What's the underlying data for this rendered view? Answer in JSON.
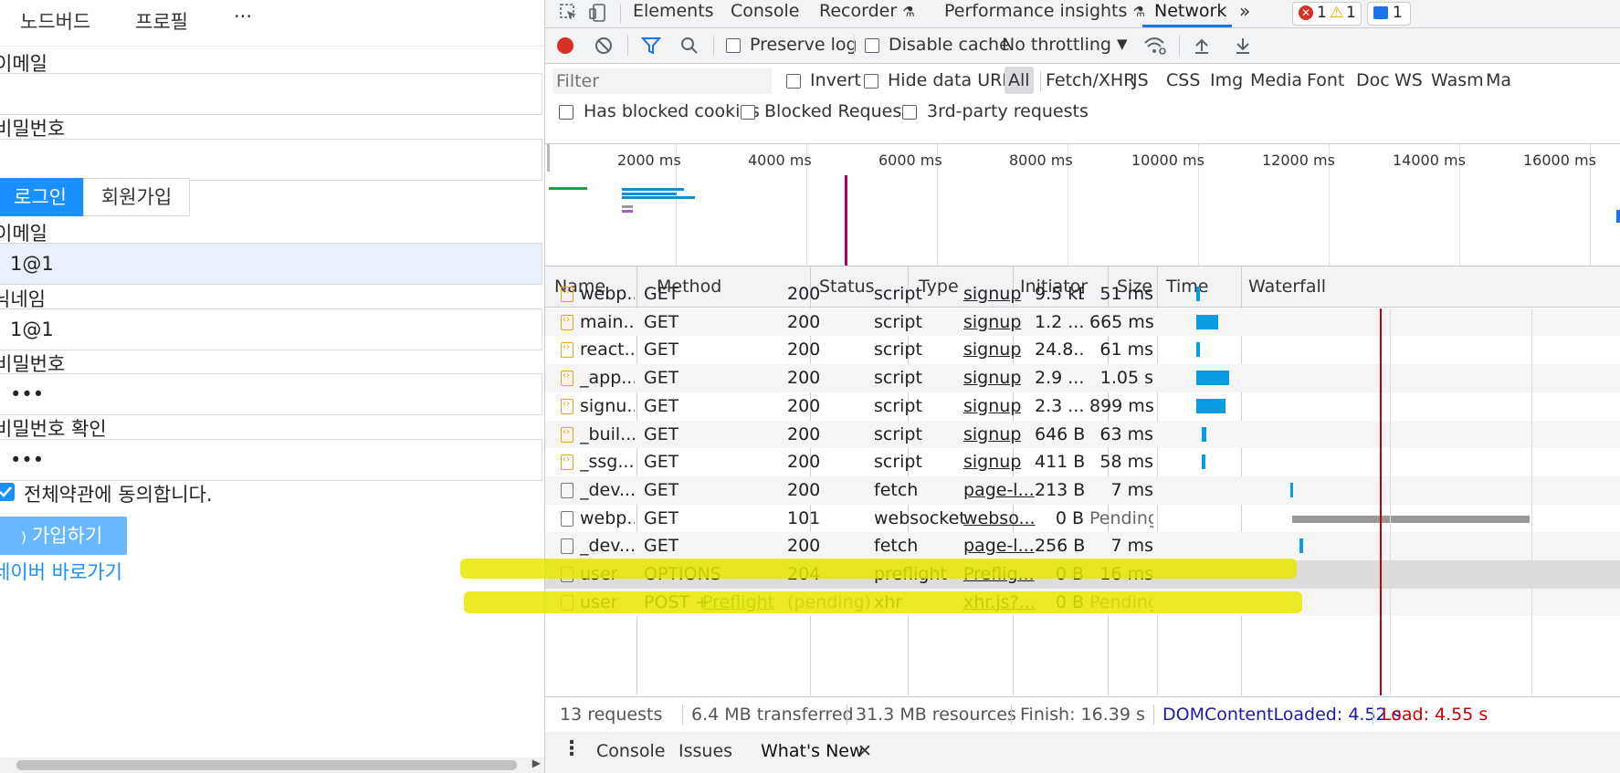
{
  "app": {
    "nav": {
      "item1": "노드버드",
      "item2": "프로필",
      "more": "···"
    },
    "login_form": {
      "email_label": "이메일",
      "password_label": "비밀번호",
      "login_button": "로그인",
      "signup_button": "회원가입"
    },
    "signup_form": {
      "email_label": "이메일",
      "email_value": "1@1",
      "nickname_label": "닉네임",
      "nickname_value": "1@1",
      "password_label": "비밀번호",
      "password_value": "•••",
      "password_confirm_label": "비밀번호 확인",
      "password_confirm_value": "•••",
      "terms_label": "전체약관에 동의합니다.",
      "submit_button": "가입하기",
      "naver_link": "네이버 바로가기"
    }
  },
  "devtools": {
    "tabs": [
      "Elements",
      "Console",
      "Recorder",
      "Performance insights",
      "Network"
    ],
    "active_tab": "Network",
    "badges": {
      "errors": "1",
      "warnings": "1",
      "messages": "1"
    },
    "toolbar": {
      "preserve_log": "Preserve log",
      "disable_cache": "Disable cache",
      "throttling": "No throttling"
    },
    "filter": {
      "placeholder": "Filter",
      "invert": "Invert",
      "hide_data_urls": "Hide data URLs",
      "types": [
        "All",
        "Fetch/XHR",
        "JS",
        "CSS",
        "Img",
        "Media",
        "Font",
        "Doc",
        "WS",
        "Wasm",
        "Ma"
      ],
      "has_blocked_cookies": "Has blocked cookies",
      "blocked_requests": "Blocked Requests",
      "third_party": "3rd-party requests"
    },
    "overview_ticks": [
      "2000 ms",
      "4000 ms",
      "6000 ms",
      "8000 ms",
      "10000 ms",
      "12000 ms",
      "14000 ms",
      "16000 ms"
    ],
    "columns": [
      "Name",
      "Method",
      "Status",
      "Type",
      "Initiator",
      "Size",
      "Time",
      "Waterfall"
    ],
    "requests": [
      {
        "name": "webp...",
        "method": "GET",
        "status": "200",
        "type": "script",
        "initiator": "signup",
        "size": "9.5 kB",
        "time": "51 ms",
        "kind": "script",
        "wf_start": 0.1,
        "wf_len": 0.012
      },
      {
        "name": "main....",
        "method": "GET",
        "status": "200",
        "type": "script",
        "initiator": "signup",
        "size": "1.2 ...",
        "time": "665 ms",
        "kind": "script",
        "wf_start": 0.1,
        "wf_len": 0.06
      },
      {
        "name": "react...",
        "method": "GET",
        "status": "200",
        "type": "script",
        "initiator": "signup",
        "size": "24.8...",
        "time": "61 ms",
        "kind": "script",
        "wf_start": 0.1,
        "wf_len": 0.012
      },
      {
        "name": "_app....",
        "method": "GET",
        "status": "200",
        "type": "script",
        "initiator": "signup",
        "size": "2.9 ...",
        "time": "1.05 s",
        "kind": "script",
        "wf_start": 0.1,
        "wf_len": 0.09
      },
      {
        "name": "signu...",
        "method": "GET",
        "status": "200",
        "type": "script",
        "initiator": "signup",
        "size": "2.3 ...",
        "time": "899 ms",
        "kind": "script",
        "wf_start": 0.1,
        "wf_len": 0.08
      },
      {
        "name": "_buil...",
        "method": "GET",
        "status": "200",
        "type": "script",
        "initiator": "signup",
        "size": "646 B",
        "time": "63 ms",
        "kind": "script",
        "wf_start": 0.115,
        "wf_len": 0.012
      },
      {
        "name": "_ssg...",
        "method": "GET",
        "status": "200",
        "type": "script",
        "initiator": "signup",
        "size": "411 B",
        "time": "58 ms",
        "kind": "script",
        "wf_start": 0.115,
        "wf_len": 0.01
      },
      {
        "name": "_dev...",
        "method": "GET",
        "status": "200",
        "type": "fetch",
        "initiator": "page-l...",
        "size": "213 B",
        "time": "7 ms",
        "kind": "doc",
        "wf_start": 0.355,
        "wf_len": 0.008
      },
      {
        "name": "webp...",
        "method": "GET",
        "status": "101",
        "type": "websocket",
        "initiator": "webso...",
        "size": "0 B",
        "time": "Pending",
        "kind": "doc",
        "wf_start": 0.36,
        "wf_len": 0.64
      },
      {
        "name": "_dev...",
        "method": "GET",
        "status": "200",
        "type": "fetch",
        "initiator": "page-l...",
        "size": "256 B",
        "time": "7 ms",
        "kind": "doc",
        "wf_start": 0.38,
        "wf_len": 0.008
      },
      {
        "name": "user",
        "method": "OPTIONS",
        "status": "204",
        "type": "preflight",
        "initiator": "Preflig...",
        "size": "0 B",
        "time": "16 ms",
        "kind": "doc",
        "wf_start": 0,
        "wf_len": 0
      },
      {
        "name": "user",
        "method": "POST + ",
        "method_link": "Preflight",
        "status": "(pending)",
        "type": "xhr",
        "initiator": "xhr.js?...",
        "size": "0 B",
        "time": "Pending",
        "kind": "doc",
        "wf_start": 0,
        "wf_len": 0
      }
    ],
    "status_bar": {
      "requests": "13 requests",
      "transferred": "6.4 MB transferred",
      "resources": "31.3 MB resources",
      "finish": "Finish: 16.39 s",
      "dom_content_loaded": "DOMContentLoaded: 4.52 s",
      "load": "Load: 4.55 s"
    },
    "drawer_tabs": [
      "Console",
      "Issues",
      "What's New"
    ],
    "colors": {
      "accent": "#1a73e8",
      "dcl": "#1a1aa6",
      "load": "#c80000",
      "highlight": "#e6e600",
      "primary": "#1890ff"
    }
  }
}
